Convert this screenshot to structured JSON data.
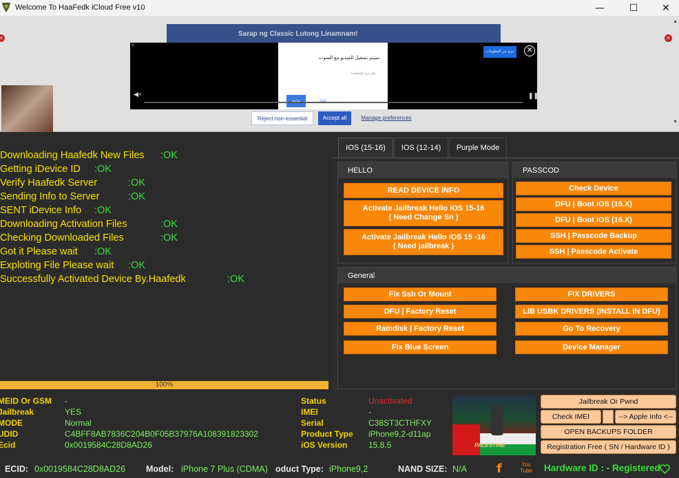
{
  "window": {
    "title": "Welcome To HaaFedk iCloud Free v10",
    "minimize": "—",
    "maximize": "☐",
    "close": "✕"
  },
  "ad": {
    "banner_text": "Sarap ng Classic Lutong Linamnam!",
    "dialog_line1": "سيتم تشغيل الفيديو مع الصوت.",
    "dialog_line2": "هل تريد المتابعة؟",
    "dialog_continue": "متابعة",
    "dialog_cancel": "إلغاء",
    "more_info": "مزيد من المعلومات",
    "reject": "Reject non-essential",
    "accept": "Accept all",
    "manage": "Manage preferences"
  },
  "log": [
    {
      "text": "Downloading Haafedk New Files",
      "ok": ":OK"
    },
    {
      "text": "Getting iDevice ID",
      "ok": ":OK"
    },
    {
      "text": "Verify Haafedk Server",
      "ok": ":OK"
    },
    {
      "text": "Sending Info to Server",
      "ok": ":OK"
    },
    {
      "text": "SENT iDevice Info",
      "ok": ":OK"
    },
    {
      "text": "Downloading Activation Files",
      "ok": ":OK"
    },
    {
      "text": "Checking Downloaded Files",
      "ok": ":OK"
    },
    {
      "text": "Got it Please wait",
      "ok": ":OK"
    },
    {
      "text": "Exploting File Please wait",
      "ok": ":OK"
    },
    {
      "text": "Successfully Activated Device By.Haafedk",
      "ok": ":OK"
    }
  ],
  "progress": {
    "value": 100,
    "label": "100%"
  },
  "tabs": [
    "IOS (15-16)",
    "IOS (12-14)",
    "Purple Mode"
  ],
  "groups": {
    "hello": {
      "title": "HELLO",
      "buttons": [
        "READ DEVICE INFO",
        "Activate Jailbreak Hello iOS 15-16\n( Need Change Sn )",
        "Activate Jailbreak Hello iOS 15 -16\n( Need jailbreak )"
      ]
    },
    "passcode": {
      "title": "PASSCOD",
      "buttons": [
        "Check Device",
        "DFU | Boot  iOS (15.X)",
        "DFU | Boot  iOS (16.X)",
        "SSH | Passcode Backup",
        "SSH | Passcode Activate"
      ]
    },
    "general": {
      "title": "General",
      "left": [
        "Fix Ssh Or Mount",
        "DFU | Factory Reset",
        "Ramdisk | Factory Reset",
        "Fix Blue Screen"
      ],
      "right": [
        "FIX DRIVERS",
        "LIB USBK DRIVERS (INSTALL IN DFU)",
        "Go To Recovery",
        "Device Manager"
      ]
    }
  },
  "device_info": {
    "left": [
      {
        "label": "MEID Or GSM",
        "value": "-"
      },
      {
        "label": "Jailbreak",
        "value": "YES"
      },
      {
        "label": "MODE",
        "value": "Normal"
      },
      {
        "label": "UDID",
        "value": "C4BFF8AB7836C204B0F05B37976A108391823302"
      },
      {
        "label": "Ecid",
        "value": "0x0019584C28D8AD26"
      }
    ],
    "right": [
      {
        "label": "Status",
        "value": "Unactivated"
      },
      {
        "label": "IMEI",
        "value": "-"
      },
      {
        "label": "Serial",
        "value": "C38ST3CTHFXY"
      },
      {
        "label": "Product Type",
        "value": "iPhone9,2-d11ap"
      },
      {
        "label": "iOS Version",
        "value": "15.8.5"
      }
    ],
    "status_color": "#e42a2a"
  },
  "poster_caption": "PALESTINE",
  "side_buttons": {
    "jailbreak": "Jailbreak Or Pwnd",
    "check_imei": "Check IMEI",
    "apple_info": "--> Apple Info <--",
    "backups": "OPEN BACKUPS FOLDER",
    "registration": "Registration Free ( SN / Hardware ID )"
  },
  "statusbar": {
    "ecid_label": "ECID:",
    "ecid": "0x0019584C28D8AD26",
    "model_label": "Model:",
    "model": "iPhone 7 Plus (CDMA)",
    "product_label": "oduct Type:",
    "product": "iPhone9,2",
    "nand_label": "NAND SIZE:",
    "nand": "N/A",
    "hwid": "Hardware ID : - Registered",
    "yt_text": "You\nTube"
  },
  "colors": {
    "accent": "#f98709",
    "log_text": "#f5e100",
    "ok": "#36e036",
    "value": "#7ef061",
    "bg": "#2b2b2b"
  }
}
